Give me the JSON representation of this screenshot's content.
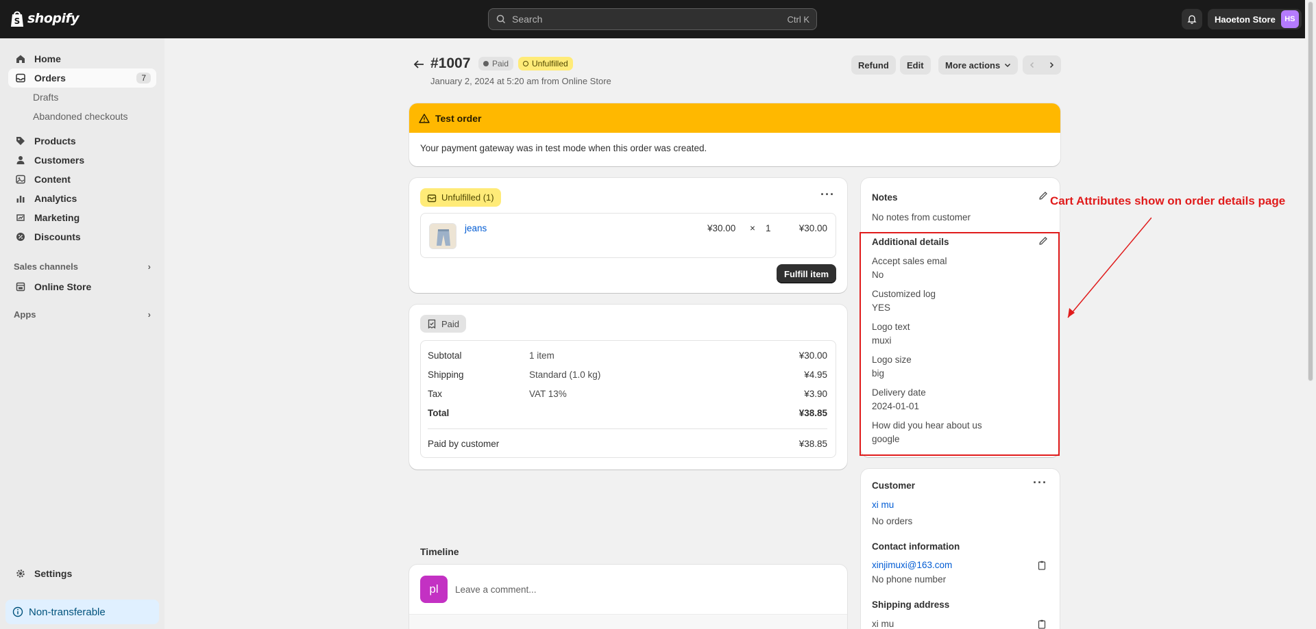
{
  "topbar": {
    "logo_text": "shopify",
    "search_placeholder": "Search",
    "search_shortcut": "Ctrl K",
    "store_name": "Haoeton Store",
    "store_initials": "HS"
  },
  "sidebar": {
    "items": [
      {
        "label": "Home",
        "icon": "home-icon"
      },
      {
        "label": "Orders",
        "icon": "orders-icon",
        "count": "7"
      },
      {
        "label": "Products",
        "icon": "tag-icon"
      },
      {
        "label": "Customers",
        "icon": "person-icon"
      },
      {
        "label": "Content",
        "icon": "image-icon"
      },
      {
        "label": "Analytics",
        "icon": "analytics-icon"
      },
      {
        "label": "Marketing",
        "icon": "marketing-icon"
      },
      {
        "label": "Discounts",
        "icon": "discount-icon"
      },
      {
        "label": "Online Store",
        "icon": "store-icon"
      },
      {
        "label": "Settings",
        "icon": "gear-icon"
      }
    ],
    "sub_items": [
      "Drafts",
      "Abandoned checkouts"
    ],
    "sections": [
      "Sales channels",
      "Apps"
    ],
    "non_transferable": "Non-transferable"
  },
  "order": {
    "id": "#1007",
    "badge_paid": "Paid",
    "badge_unfulfilled": "Unfulfilled",
    "subtitle": "January 2, 2024 at 5:20 am from Online Store",
    "actions": {
      "refund": "Refund",
      "edit": "Edit",
      "more": "More actions"
    }
  },
  "banner": {
    "title": "Test order",
    "body": "Your payment gateway was in test mode when this order was created."
  },
  "fulfillment": {
    "badge": "Unfulfilled (1)",
    "item_name": "jeans",
    "unit_price": "¥30.00",
    "times": "×",
    "quantity": "1",
    "line_total": "¥30.00",
    "fulfill_button": "Fulfill item"
  },
  "payment": {
    "badge": "Paid",
    "rows": [
      {
        "label": "Subtotal",
        "detail": "1 item",
        "amount": "¥30.00"
      },
      {
        "label": "Shipping",
        "detail": "Standard (1.0 kg)",
        "amount": "¥4.95"
      },
      {
        "label": "Tax",
        "detail": "VAT 13%",
        "amount": "¥3.90"
      },
      {
        "label": "Total",
        "detail": "",
        "amount": "¥38.85"
      }
    ],
    "paid_label": "Paid by customer",
    "paid_amount": "¥38.85"
  },
  "timeline": {
    "title": "Timeline",
    "avatar": "pl",
    "comment_placeholder": "Leave a comment..."
  },
  "notes": {
    "title": "Notes",
    "empty": "No notes from customer"
  },
  "additional": {
    "title": "Additional details",
    "fields": [
      {
        "label": "Accept sales emal",
        "value": "No"
      },
      {
        "label": "Customized log",
        "value": "YES"
      },
      {
        "label": "Logo text",
        "value": "muxi"
      },
      {
        "label": "Logo size",
        "value": "big"
      },
      {
        "label": "Delivery date",
        "value": "2024-01-01"
      },
      {
        "label": "How did you hear about us",
        "value": "google"
      }
    ]
  },
  "customer": {
    "title": "Customer",
    "name": "xi mu",
    "orders": "No orders",
    "contact_title": "Contact information",
    "email": "xinjimuxi@163.com",
    "phone": "No phone number",
    "shipping_title": "Shipping address",
    "shipping_name": "xi mu"
  },
  "annotation": {
    "text": "Cart Attributes show on order details page",
    "color": "#e01b1b"
  }
}
